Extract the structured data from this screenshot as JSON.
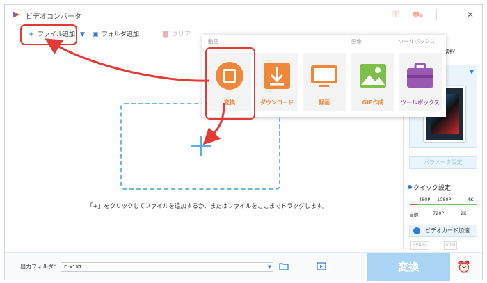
{
  "window": {
    "title": "ビデオコンバータ",
    "icons": [
      "key-icon",
      "cart-icon"
    ],
    "controls": [
      "minimize-icon",
      "close-icon"
    ]
  },
  "toolbar": {
    "add_file": "ファイル追加",
    "add_folder": "フォルダ追加",
    "clear": "クリア"
  },
  "main": {
    "hint": "「+」をクリックしてファイルを追加するか、またはファイルをここまでドラッグします。"
  },
  "popup": {
    "sections": [
      "動画",
      "画像",
      "ツールボックス"
    ],
    "tiles": [
      {
        "label": "変換",
        "icon": "film-icon"
      },
      {
        "label": "ダウンロード",
        "icon": "download-icon"
      },
      {
        "label": "録画",
        "icon": "screen-record-icon"
      },
      {
        "label": "GIF作成",
        "icon": "image-icon"
      },
      {
        "label": "ツールボックス",
        "icon": "toolbox-icon"
      }
    ]
  },
  "right_panel": {
    "format_label": "を選択",
    "param_button": "パラメータ設定",
    "quick_setting": "クイック設定",
    "quality_top": [
      "480P",
      "1080P",
      "4K"
    ],
    "quality_bottom": [
      "自動",
      "720P",
      "2K"
    ],
    "gpu_button": "ビデオカード加速",
    "vendors": [
      "NVIDIA",
      "Intel"
    ]
  },
  "bottom": {
    "output_label": "出力フォルダ：",
    "output_path": "D:¥1¥1",
    "convert": "変換"
  },
  "colors": {
    "accent": "#2b7cd6",
    "tile_orange": "#f0883c",
    "annotation_red": "#e53935",
    "convert_disabled": "#a9d4f5"
  }
}
